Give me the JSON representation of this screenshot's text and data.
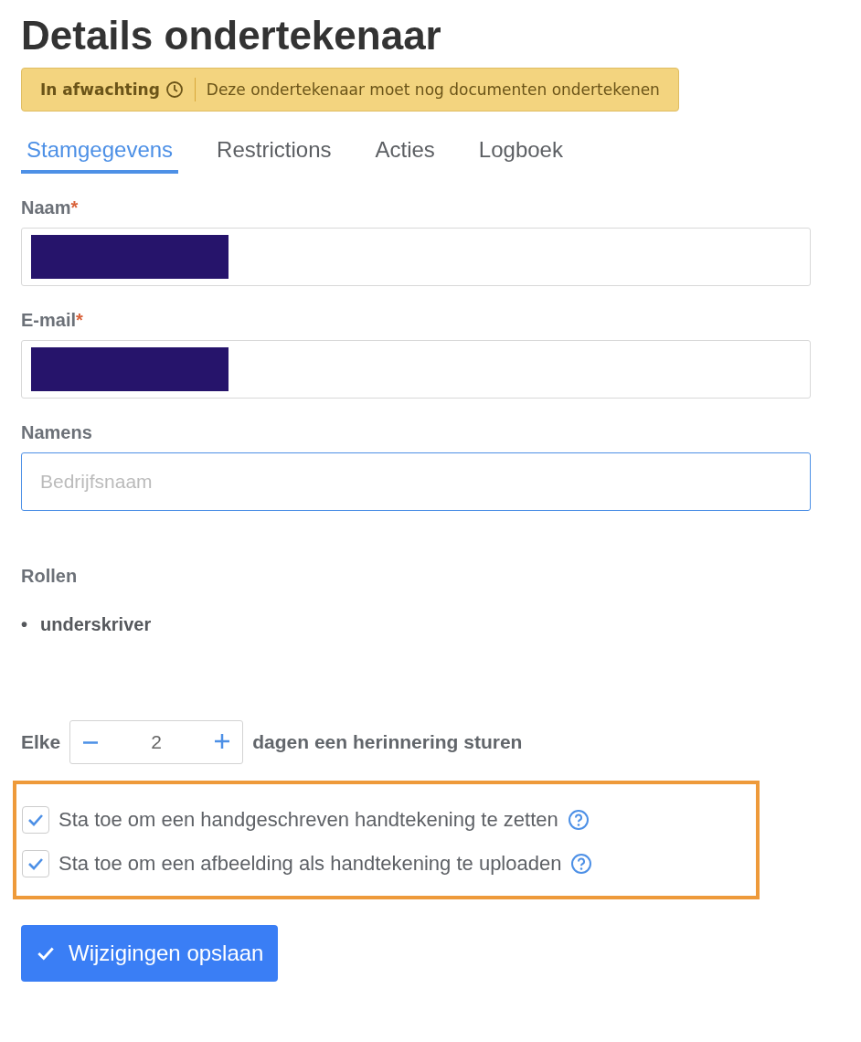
{
  "title": "Details ondertekenaar",
  "status": {
    "label": "In afwachting",
    "message": "Deze ondertekenaar moet nog documenten ondertekenen"
  },
  "tabs": [
    {
      "label": "Stamgegevens",
      "selected": true
    },
    {
      "label": "Restrictions",
      "selected": false
    },
    {
      "label": "Acties",
      "selected": false
    },
    {
      "label": "Logboek",
      "selected": false
    }
  ],
  "fields": [
    {
      "label": "Naam",
      "required_mark": "*",
      "redacted": true,
      "focused": false
    },
    {
      "label": "E-mail",
      "required_mark": "*",
      "redacted": true,
      "focused": false
    },
    {
      "label": "Namens",
      "redacted": false,
      "focused": true,
      "placeholder": "Bedrijfsnaam"
    }
  ],
  "roles": {
    "label": "Rollen",
    "items": [
      {
        "bullet": "•",
        "text": "underskriver"
      }
    ]
  },
  "reminder": {
    "prefix": "Elke",
    "value": "2",
    "suffix": "dagen een herinnering sturen"
  },
  "options": {
    "highlighted": true,
    "items": [
      {
        "label": "Sta toe om een handgeschreven handtekening te zetten",
        "checked": true
      },
      {
        "label": "Sta toe om een afbeelding als handtekening te uploaden",
        "checked": true
      }
    ]
  },
  "save_button": "Wijzigingen opslaan"
}
